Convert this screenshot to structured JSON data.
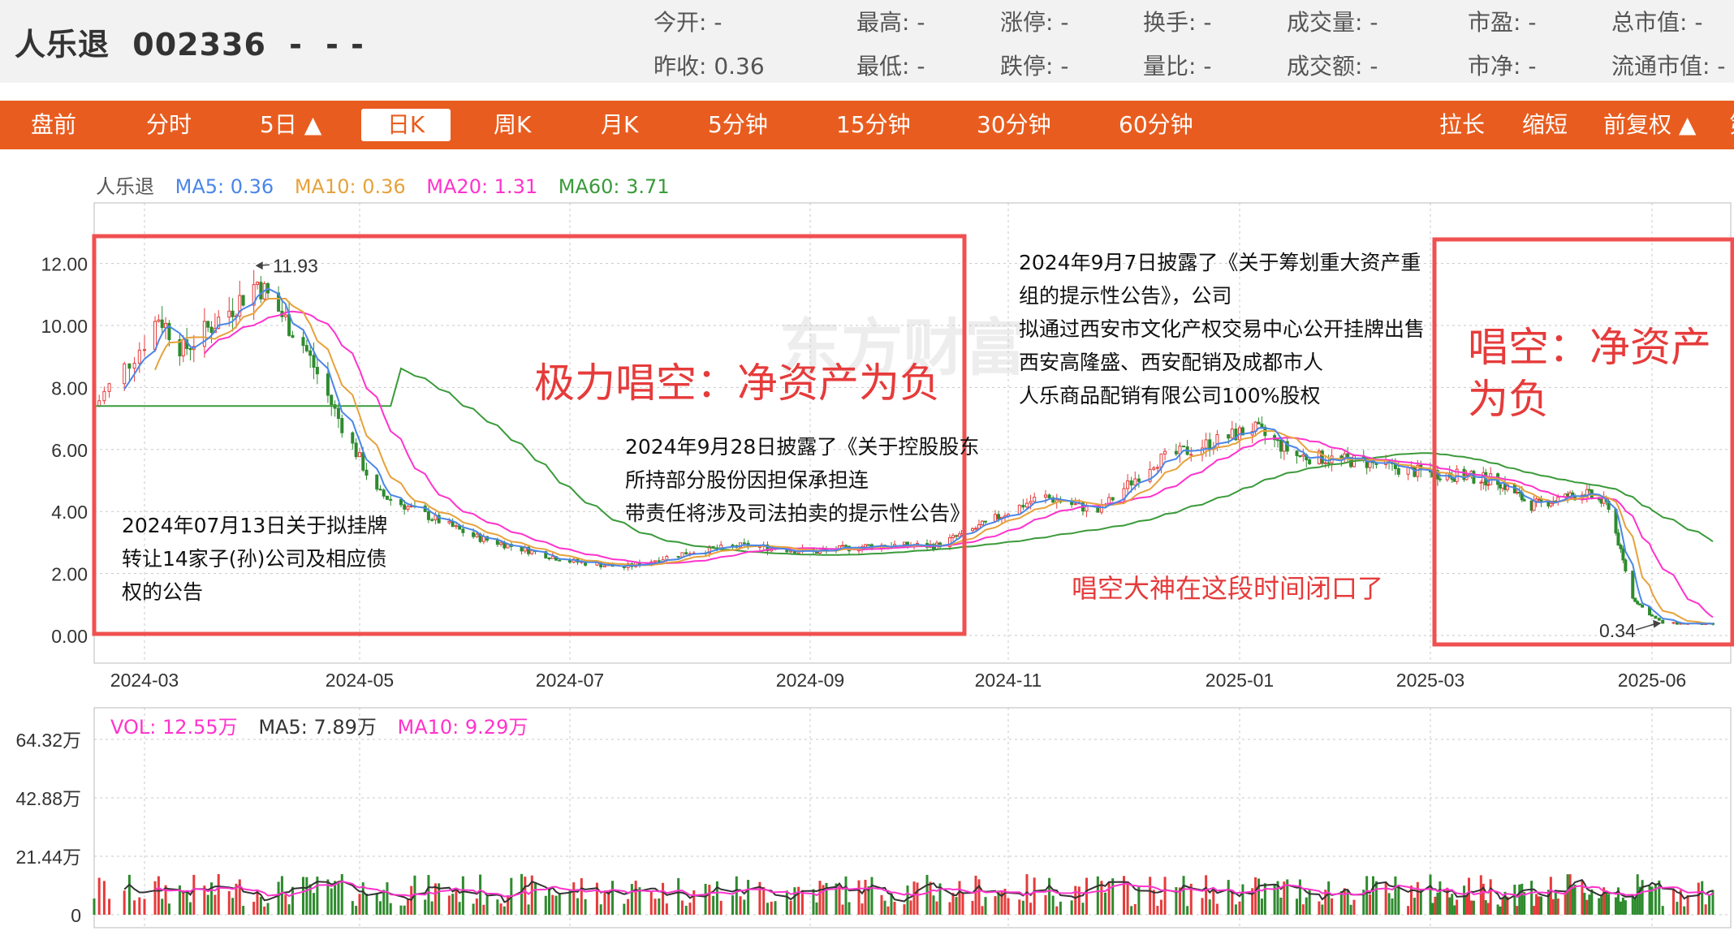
{
  "header": {
    "name": "人乐退",
    "code": "002336",
    "price": "-",
    "change": "- -",
    "quotes": [
      {
        "label": "今开:",
        "value": "-"
      },
      {
        "label": "最高:",
        "value": "-"
      },
      {
        "label": "涨停:",
        "value": "-"
      },
      {
        "label": "换手:",
        "value": "-"
      },
      {
        "label": "成交量:",
        "value": "-"
      },
      {
        "label": "市盈:",
        "value": "-"
      },
      {
        "label": "总市值:",
        "value": "-"
      },
      {
        "label": "昨收:",
        "value": "0.36"
      },
      {
        "label": "最低:",
        "value": "-"
      },
      {
        "label": "跌停:",
        "value": "-"
      },
      {
        "label": "量比:",
        "value": "-"
      },
      {
        "label": "成交额:",
        "value": "-"
      },
      {
        "label": "市净:",
        "value": "-"
      },
      {
        "label": "流通市值:",
        "value": "-"
      }
    ]
  },
  "tabs": [
    "盘前",
    "分时",
    "5日 ▲",
    "日K",
    "周K",
    "月K",
    "5分钟",
    "15分钟",
    "30分钟",
    "60分钟",
    "拉长",
    "缩短",
    "前复权 ▲",
    "第"
  ],
  "active_tab": "日K",
  "legend": {
    "name": "人乐退",
    "ma5": "MA5: 0.36",
    "ma10": "MA10: 0.36",
    "ma20": "MA20: 1.31",
    "ma60": "MA60: 3.71"
  },
  "vol_legend": {
    "vol": "VOL: 12.55万",
    "ma5": "MA5: 7.89万",
    "ma10": "MA10: 9.29万"
  },
  "colors": {
    "up": "#e63b3b",
    "down": "#2e8b2e",
    "ma5": "#4a86e8",
    "ma10": "#e6a23c",
    "ma20": "#ff33cc",
    "ma60": "#3a9a3a",
    "highlight": "#f05050",
    "accent": "#e85d1f"
  },
  "watermark": "东方财富",
  "chart_data": {
    "type": "candlestick",
    "x_ticks": [
      "2024-03",
      "2024-05",
      "2024-07",
      "2024-09",
      "2024-11",
      "2025-01",
      "2025-03",
      "2025-06"
    ],
    "y_ticks": [
      "12.00",
      "10.00",
      "8.00",
      "6.00",
      "4.00",
      "2.00",
      "0.00"
    ],
    "ylim": [
      0,
      13
    ],
    "max_label": "11.93",
    "min_label": "0.34",
    "close_series": [
      {
        "date": "2024-02-20",
        "close": 7.4
      },
      {
        "date": "2024-03-05",
        "close": 10.3
      },
      {
        "date": "2024-03-12",
        "close": 9.2
      },
      {
        "date": "2024-03-26",
        "close": 10.6
      },
      {
        "date": "2024-04-02",
        "close": 11.4
      },
      {
        "date": "2024-04-15",
        "close": 9.4
      },
      {
        "date": "2024-04-25",
        "close": 7.0
      },
      {
        "date": "2024-05-06",
        "close": 4.6
      },
      {
        "date": "2024-05-20",
        "close": 3.9
      },
      {
        "date": "2024-06-03",
        "close": 3.2
      },
      {
        "date": "2024-06-17",
        "close": 2.8
      },
      {
        "date": "2024-07-01",
        "close": 2.4
      },
      {
        "date": "2024-07-15",
        "close": 2.2
      },
      {
        "date": "2024-08-01",
        "close": 2.7
      },
      {
        "date": "2024-08-15",
        "close": 2.9
      },
      {
        "date": "2024-09-02",
        "close": 2.7
      },
      {
        "date": "2024-09-20",
        "close": 2.9
      },
      {
        "date": "2024-10-10",
        "close": 2.9
      },
      {
        "date": "2024-10-25",
        "close": 3.6
      },
      {
        "date": "2024-11-10",
        "close": 4.5
      },
      {
        "date": "2024-11-25",
        "close": 4.0
      },
      {
        "date": "2024-12-10",
        "close": 5.6
      },
      {
        "date": "2024-12-25",
        "close": 6.2
      },
      {
        "date": "2025-01-06",
        "close": 6.7
      },
      {
        "date": "2025-01-20",
        "close": 5.8
      },
      {
        "date": "2025-02-10",
        "close": 5.6
      },
      {
        "date": "2025-02-25",
        "close": 5.3
      },
      {
        "date": "2025-03-10",
        "close": 5.2
      },
      {
        "date": "2025-03-31",
        "close": 5.0
      },
      {
        "date": "2025-04-14",
        "close": 4.2
      },
      {
        "date": "2025-05-06",
        "close": 4.6
      },
      {
        "date": "2025-05-16",
        "close": 4.2
      },
      {
        "date": "2025-05-26",
        "close": 1.2
      },
      {
        "date": "2025-06-06",
        "close": 0.4
      },
      {
        "date": "2025-06-20",
        "close": 0.36
      }
    ],
    "volume": {
      "y_ticks": [
        "64.32万",
        "42.88万",
        "21.44万",
        "0"
      ],
      "ylim": [
        0,
        64.32
      ],
      "unit": "万"
    }
  },
  "annotations": {
    "left_red": "极力唱空：净资产为负",
    "right_red": "唱空：净资产为负",
    "right_red_lines": [
      "唱空：净资产",
      "为负"
    ],
    "middle_red": "唱空大神在这段时间闭口了",
    "note_jul": [
      "2024年07月13日关于拟挂牌",
      "转让14家子(孙)公司及相应债",
      "权的公告"
    ],
    "note_sep28": [
      "2024年9月28日披露了《关于控股股东",
      "所持部分股份因担保承担连",
      "带责任将涉及司法拍卖的提示性公告》"
    ],
    "note_sep7": [
      "2024年9月7日披露了《关于筹划重大资产重",
      "组的提示性公告》，公司",
      "拟通过西安市文化产权交易中心公开挂牌出售",
      "西安高隆盛、西安配销及成都市人",
      "人乐商品配销有限公司100%股权"
    ]
  }
}
